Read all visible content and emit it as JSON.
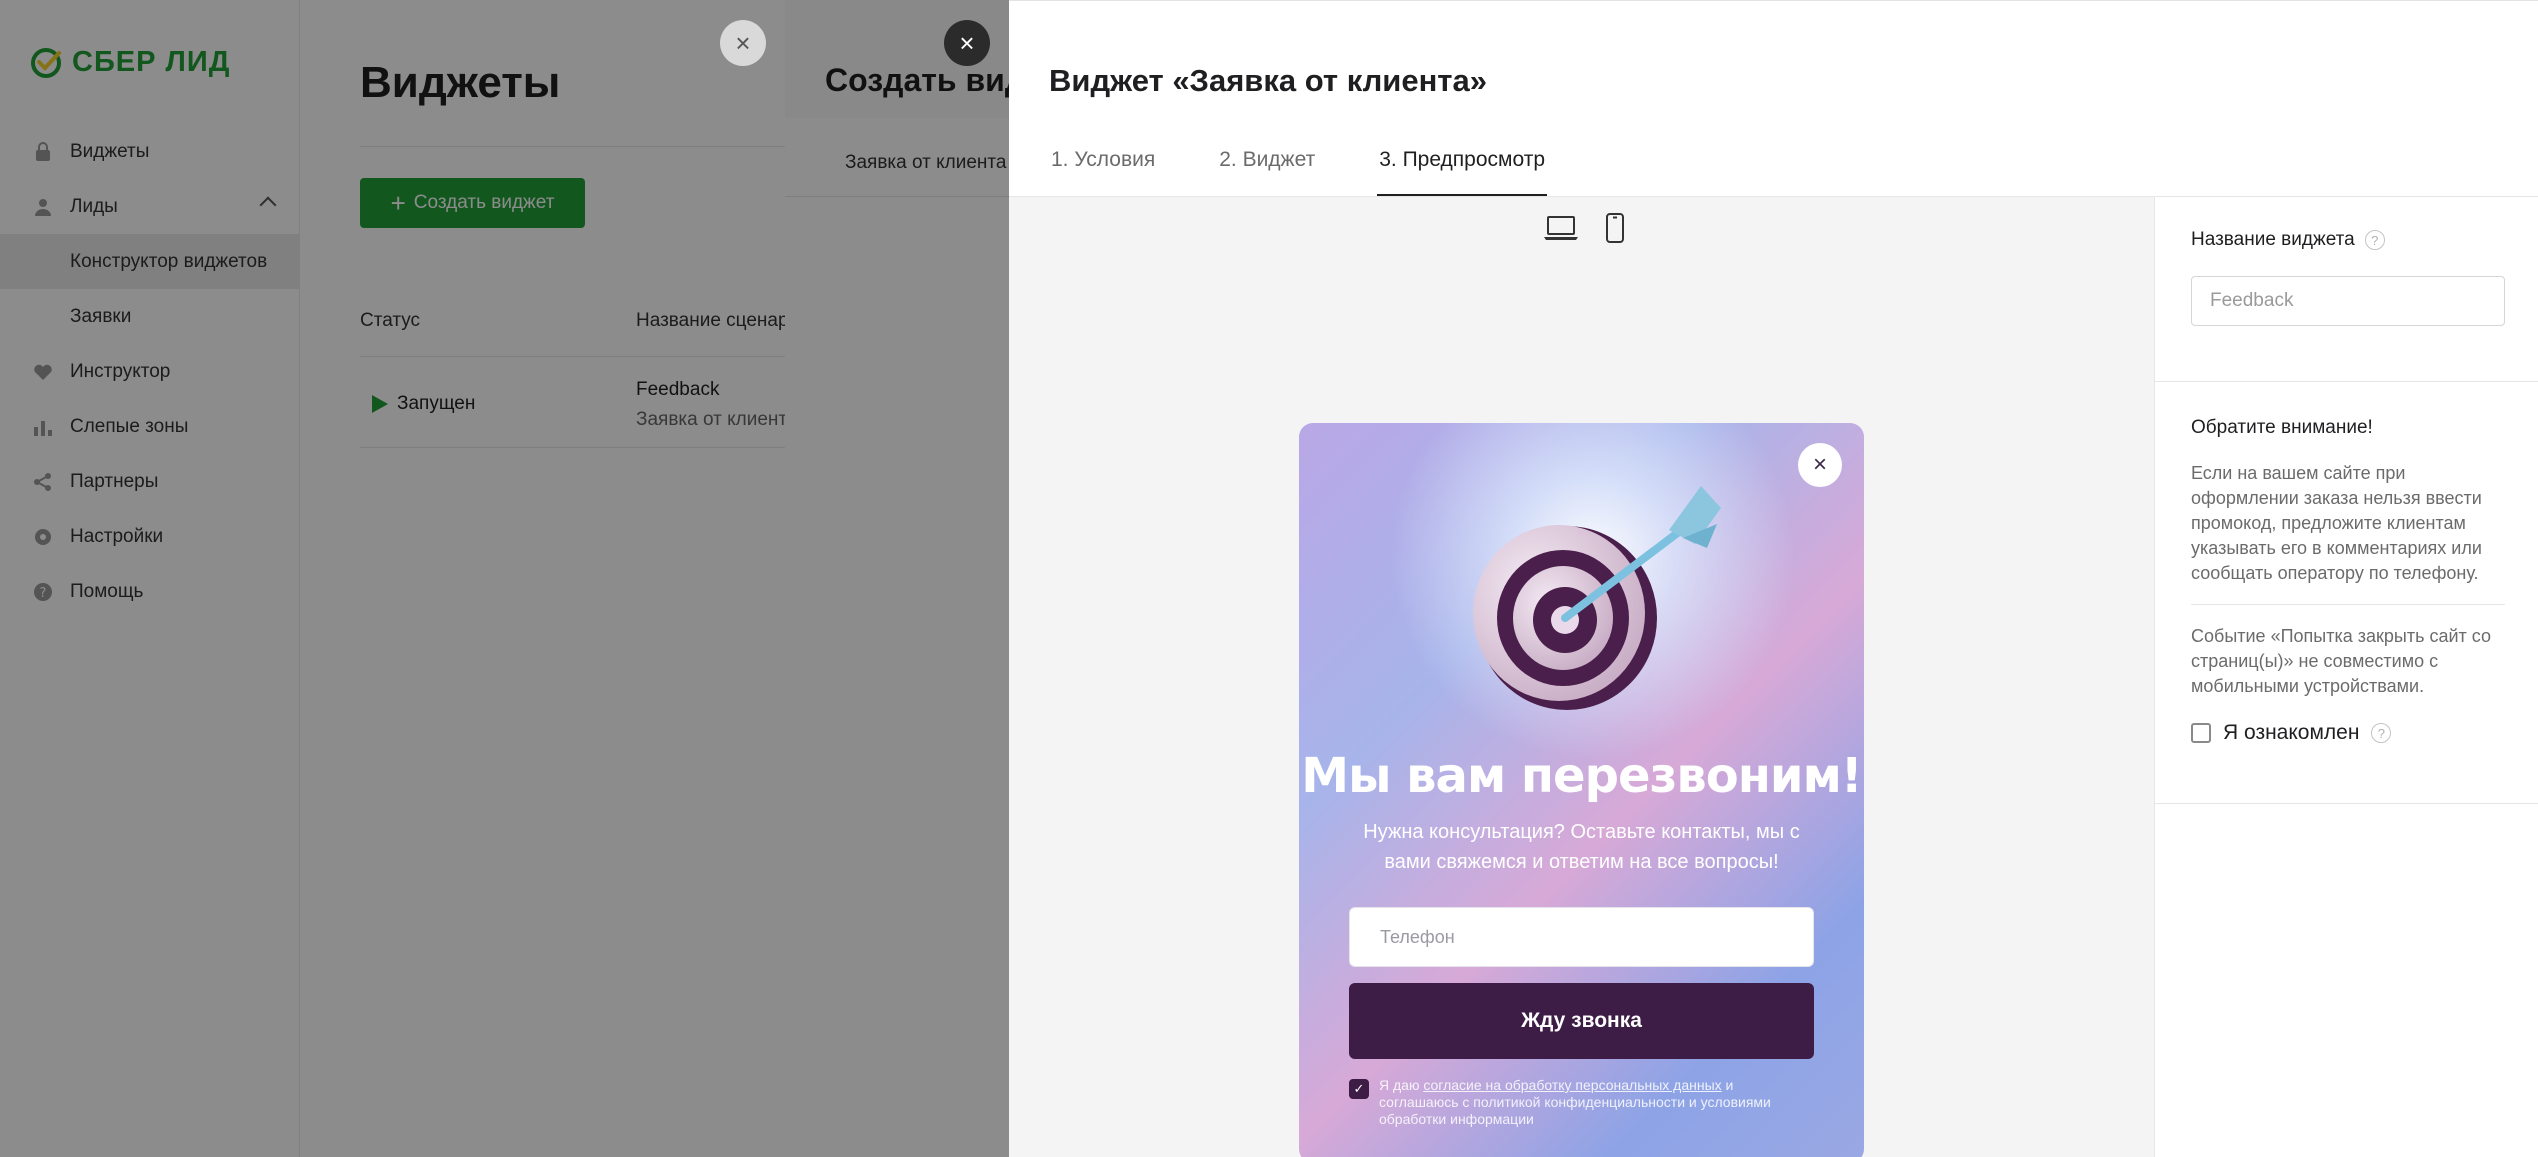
{
  "app": {
    "logo_text": "СБЕР ЛИД",
    "brand_color": "#21a038"
  },
  "sidebar": {
    "items": [
      {
        "label": "Виджеты",
        "icon": "lock-icon"
      },
      {
        "label": "Лиды",
        "icon": "person-icon"
      },
      {
        "label": "Конструктор виджетов",
        "icon": ""
      },
      {
        "label": "Заявки",
        "icon": ""
      },
      {
        "label": "Инструктор",
        "icon": "heart-icon"
      },
      {
        "label": "Слепые зоны",
        "icon": "bar-chart-icon"
      },
      {
        "label": "Партнеры",
        "icon": "share-icon"
      },
      {
        "label": "Настройки",
        "icon": "gear-icon"
      },
      {
        "label": "Помощь",
        "icon": "help-icon"
      }
    ]
  },
  "page": {
    "title": "Виджеты",
    "create_button": "Создать виджет",
    "columns": {
      "status": "Статус",
      "name": "Название сценар"
    },
    "row": {
      "status": "Запущен",
      "name": "Feedback",
      "subtitle": "Заявка от клиент"
    }
  },
  "panel2": {
    "title": "Создать вид",
    "tab": "Заявка от клиента"
  },
  "panel3": {
    "title": "Виджет «Заявка от клиента»",
    "tabs": [
      "1. Условия",
      "2. Виджет",
      "3. Предпросмотр"
    ],
    "active_tab": "3. Предпросмотр"
  },
  "widget": {
    "heading": "Мы вам перезвоним!",
    "subtitle": "Нужна консультация? Оставьте контакты, мы с вами свяжемся и ответим на все вопросы!",
    "phone_placeholder": "Телефон",
    "submit": "Жду звонка",
    "consent_prefix": "Я даю ",
    "consent_link": "согласие на обработку персональных данных",
    "consent_suffix": " и соглашаюсь с политикой конфиденциальности и условиями обработки информации",
    "button_color": "#3d1c45"
  },
  "settings": {
    "name_label": "Название виджета",
    "name_placeholder": "Feedback",
    "note_title": "Обратите внимание!",
    "note_1": "Если на вашем сайте при оформлении заказа нельзя ввести промокод, предложите клиентам указывать его в комментариях или сообщать оператору по телефону.",
    "note_2": "Событие «Попытка закрыть сайт со страниц(ы)» не совместимо с мобильными устройствами.",
    "ack_label": "Я ознакомлен"
  }
}
